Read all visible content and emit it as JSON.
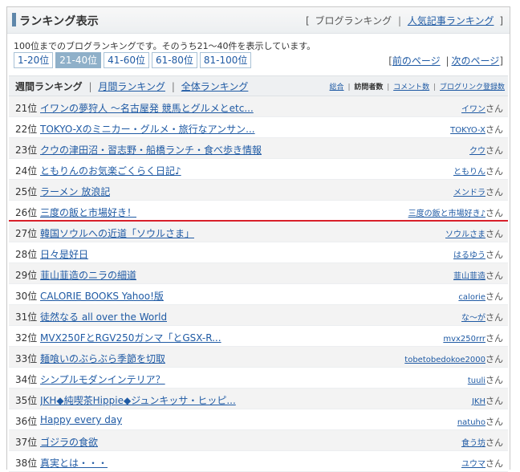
{
  "title": "ランキング表示",
  "title_links": {
    "open_bracket": "[",
    "blog_ranking": "ブログランキング",
    "separator": "|",
    "popular_ranking": "人気記事ランキング",
    "close_bracket": "]"
  },
  "description": "100位までのブログランキングです。そのうち21〜40件を表示しています。",
  "pages": [
    {
      "label": "1-20位",
      "active": false
    },
    {
      "label": "21-40位",
      "active": true
    },
    {
      "label": "41-60位",
      "active": false
    },
    {
      "label": "61-80位",
      "active": false
    },
    {
      "label": "81-100位",
      "active": false
    }
  ],
  "pagination": {
    "open": "[",
    "prev": "前のページ",
    "separator": "|",
    "next": "次のページ",
    "close": "]"
  },
  "tabs": {
    "weekly": "週間ランキング",
    "monthly": "月間ランキング",
    "overall": "全体ランキング",
    "separator": "|"
  },
  "sort_links": {
    "total": "総合",
    "visitors": "訪問者数",
    "comments": "コメント数",
    "registrations": "ブログリンク登録数",
    "separator": "|"
  },
  "honorific": "さん",
  "rows": [
    {
      "rank": "21位",
      "title": "イワンの夢狩人 〜名古屋発 競馬とグルメとetc...",
      "owner": "イワン"
    },
    {
      "rank": "22位",
      "title": "TOKYO-Xのミニカー・グルメ・旅行なアンサン...",
      "owner": "TOKYO-X"
    },
    {
      "rank": "23位",
      "title": "クウの津田沼・習志野・船橋ランチ・食べ歩き情報",
      "owner": "クウ"
    },
    {
      "rank": "24位",
      "title": "ともりんのお気楽ごくらく日記♪",
      "owner": "ともりん"
    },
    {
      "rank": "25位",
      "title": "ラーメン 放浪記",
      "owner": "メンドラ"
    },
    {
      "rank": "26位",
      "title": "三度の飯と市場好き！",
      "owner": "三度の飯と市場好き♪"
    },
    {
      "rank": "27位",
      "title": "韓国ソウルへの近道「ソウルさま」",
      "owner": "ソウルさま"
    },
    {
      "rank": "28位",
      "title": "日々是好日",
      "owner": "はるゆう"
    },
    {
      "rank": "29位",
      "title": "韮山韮造のニラの細道",
      "owner": "韮山韮造"
    },
    {
      "rank": "30位",
      "title": "CALORIE BOOKS Yahoo!版",
      "owner": "calorie"
    },
    {
      "rank": "31位",
      "title": "徒然なる all over the World",
      "owner": "な〜が"
    },
    {
      "rank": "32位",
      "title": "MVX250FとRGV250ガンマ「とGSX-R...",
      "owner": "mvx250rrr"
    },
    {
      "rank": "33位",
      "title": "麺喰いのぶらぶら季節を切取",
      "owner": "tobetobedokoe2000"
    },
    {
      "rank": "34位",
      "title": "シンプルモダンインテリア？",
      "owner": "tuuli"
    },
    {
      "rank": "35位",
      "title": "JKH◆純喫茶Hippie◆ジュンキッサ・ヒッピ...",
      "owner": "JKH"
    },
    {
      "rank": "36位",
      "title": "Happy every day",
      "owner": "natuho"
    },
    {
      "rank": "37位",
      "title": "ゴジラの食欲",
      "owner": "食う坊"
    },
    {
      "rank": "38位",
      "title": "真実とは・・・",
      "owner": "ユウマ"
    }
  ]
}
